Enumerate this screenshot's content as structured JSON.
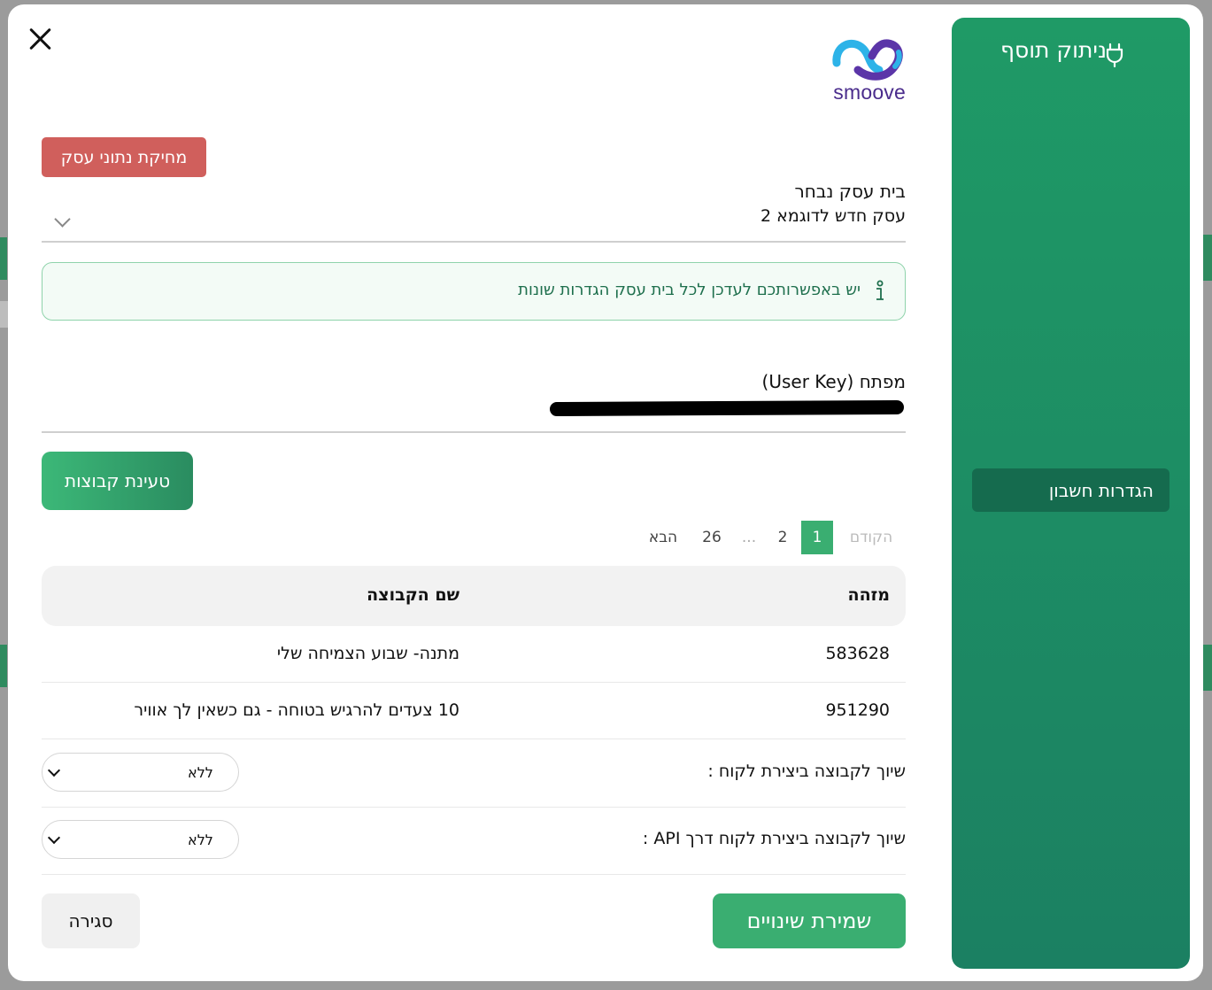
{
  "modal": {
    "close_icon": "close-icon",
    "logo_text": "smoove",
    "delete_business_label": "מחיקת נתוני עסק",
    "business_select": {
      "label": "בית עסק נבחר",
      "value": "עסק חדש לדוגמא 2"
    },
    "info_text": "יש באפשרותכם לעדכן לכל בית עסק הגדרות שונות",
    "user_key_label": "מפתח (User Key)",
    "load_groups_label": "טעינת קבוצות",
    "pagination": {
      "prev": "הקודם",
      "pages": [
        "1",
        "2",
        "...",
        "26"
      ],
      "next": "הבא",
      "current": "1"
    },
    "table": {
      "headers": {
        "id": "מזהה",
        "name": "שם הקבוצה"
      },
      "rows": [
        {
          "id": "583628",
          "name": "מתנה- שבוע הצמיחה שלי"
        },
        {
          "id": "951290",
          "name": "10 צעדים להרגיש בטוחה - גם כשאין לך אוויר"
        }
      ]
    },
    "assign_customer": {
      "label": "שיוך לקבוצה ביצירת לקוח :",
      "value": "ללא"
    },
    "assign_api": {
      "label": "שיוך לקבוצה ביצירת לקוח דרך API :",
      "value": "ללא"
    },
    "save_label": "שמירת שינויים",
    "close_label": "סגירה"
  },
  "side_panel": {
    "title": "ניתוק תוסף",
    "account_settings_label": "הגדרות חשבון"
  },
  "colors": {
    "primary_green": "#3aae71",
    "side_panel_green": "#1b8062",
    "danger_red": "#d05f5c",
    "logo_purple": "#4a2c8c",
    "logo_blue": "#2db3e8"
  }
}
